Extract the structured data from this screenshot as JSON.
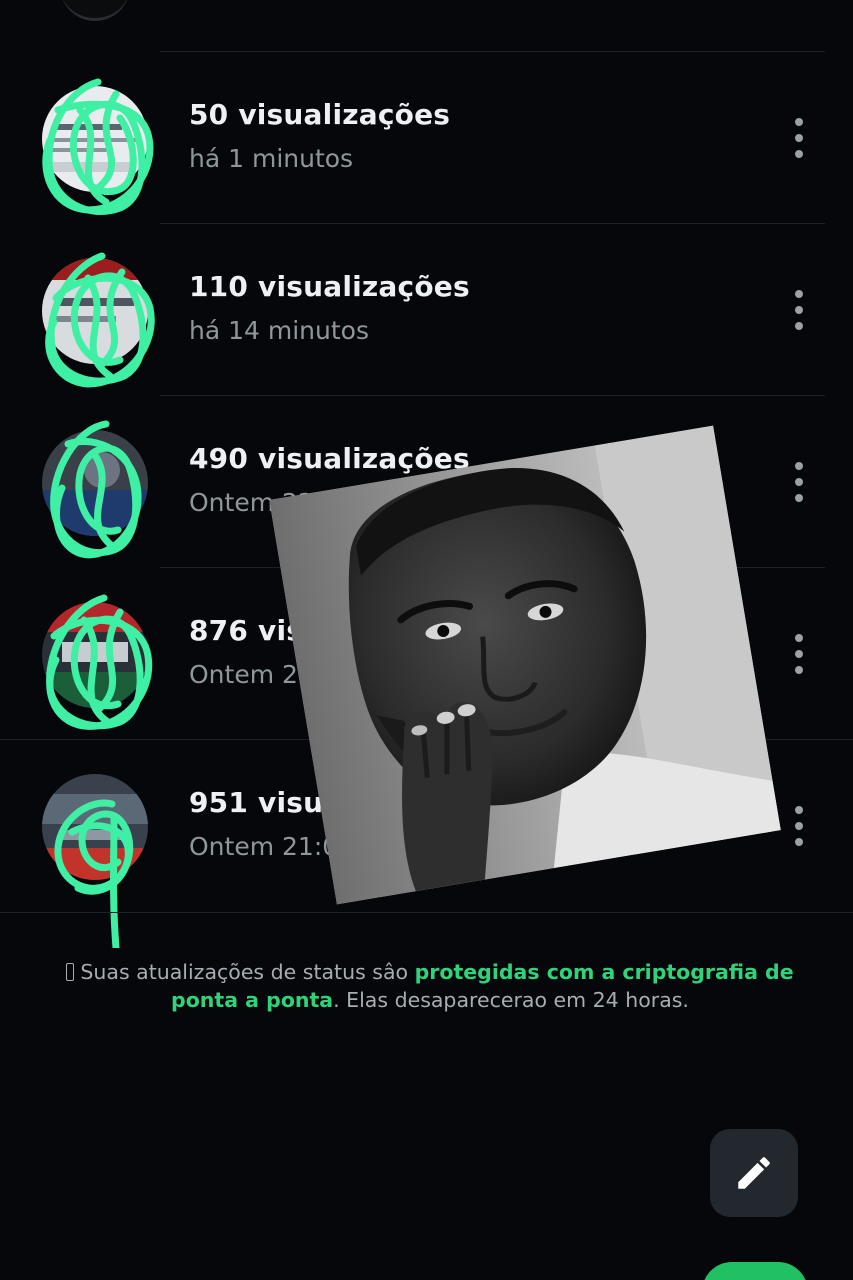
{
  "status_list": {
    "items": [
      {
        "views": "50 visualizações",
        "time": "há 1 minutos"
      },
      {
        "views": "110 visualizações",
        "time": "há 14 minutos"
      },
      {
        "views": "490 visualizações",
        "time": "Ontem 22:"
      },
      {
        "views": "876 visu",
        "time": "Ontem 21"
      },
      {
        "views": "951 visuali",
        "time": "Ontem 21:01"
      }
    ]
  },
  "footer": {
    "text_before": "Suas atualizações de status sâo ",
    "link_text": "protegidas com a criptografia de ponta a ponta",
    "text_after": ". Elas desaparecerao em 24 horas."
  },
  "icons": {
    "row_menu": "more-vertical-icon",
    "fab": "pencil-icon"
  },
  "colors": {
    "background": "#05070a",
    "scribble": "#3ff0a4",
    "link": "#2fd37a",
    "fab_main": "#21c063"
  }
}
